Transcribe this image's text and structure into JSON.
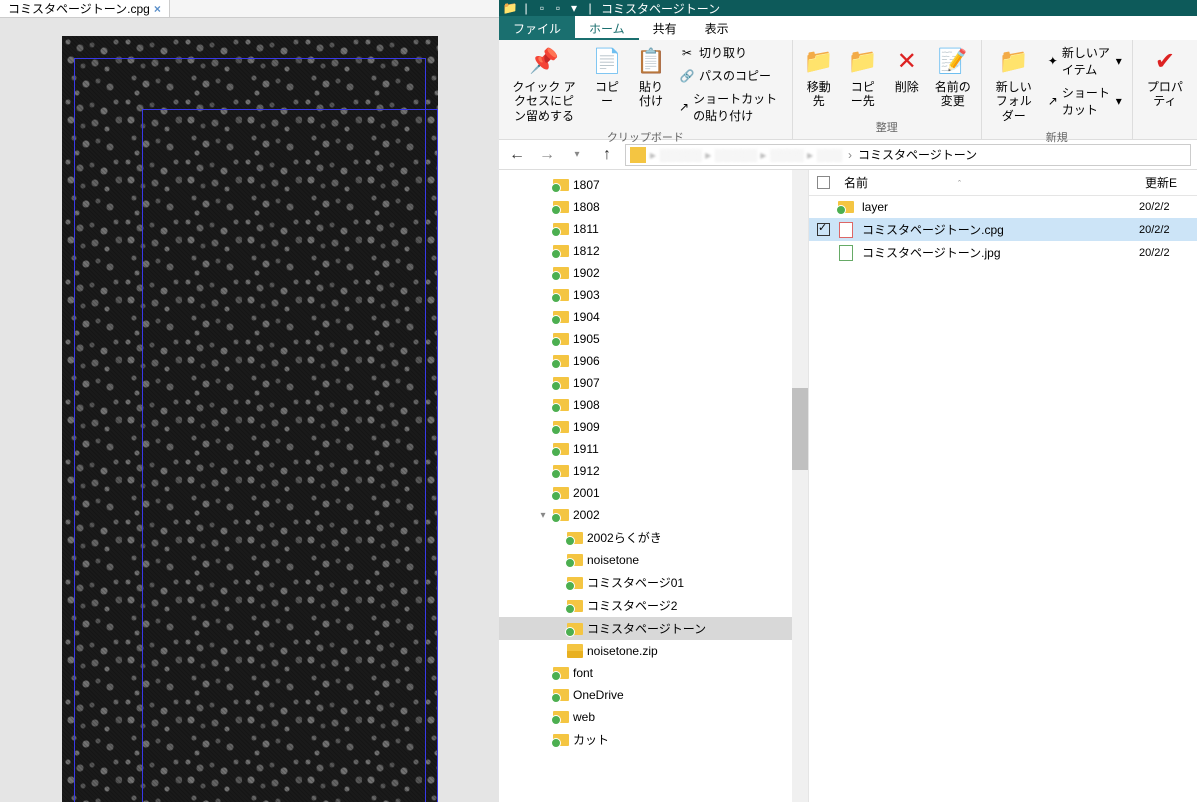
{
  "editor": {
    "tab_name": "コミスタページトーン.cpg"
  },
  "explorer": {
    "title": "コミスタページトーン",
    "menu": {
      "file": "ファイル",
      "home": "ホーム",
      "share": "共有",
      "view": "表示"
    },
    "ribbon": {
      "pin": "クイック アクセスにピン留めする",
      "copy": "コピー",
      "paste": "貼り付け",
      "cut": "切り取り",
      "copy_path": "パスのコピー",
      "paste_shortcut": "ショートカットの貼り付け",
      "clipboard": "クリップボード",
      "move_to": "移動先",
      "copy_to": "コピー先",
      "delete": "削除",
      "rename": "名前の変更",
      "organize": "整理",
      "new_folder": "新しいフォルダー",
      "new_item": "新しいアイテム",
      "shortcut": "ショートカット",
      "new": "新規",
      "properties": "プロパティ"
    },
    "breadcrumb": {
      "current": "コミスタページトーン"
    },
    "tree": [
      {
        "name": "1807",
        "indent": 2,
        "chev": ""
      },
      {
        "name": "1808",
        "indent": 2,
        "chev": ""
      },
      {
        "name": "1811",
        "indent": 2,
        "chev": ""
      },
      {
        "name": "1812",
        "indent": 2,
        "chev": ""
      },
      {
        "name": "1902",
        "indent": 2,
        "chev": ""
      },
      {
        "name": "1903",
        "indent": 2,
        "chev": ""
      },
      {
        "name": "1904",
        "indent": 2,
        "chev": ""
      },
      {
        "name": "1905",
        "indent": 2,
        "chev": ""
      },
      {
        "name": "1906",
        "indent": 2,
        "chev": ""
      },
      {
        "name": "1907",
        "indent": 2,
        "chev": ""
      },
      {
        "name": "1908",
        "indent": 2,
        "chev": ""
      },
      {
        "name": "1909",
        "indent": 2,
        "chev": ""
      },
      {
        "name": "1911",
        "indent": 2,
        "chev": ""
      },
      {
        "name": "1912",
        "indent": 2,
        "chev": ""
      },
      {
        "name": "2001",
        "indent": 2,
        "chev": ""
      },
      {
        "name": "2002",
        "indent": 2,
        "chev": "▾"
      },
      {
        "name": "2002らくがき",
        "indent": 3,
        "chev": ""
      },
      {
        "name": "noisetone",
        "indent": 3,
        "chev": ""
      },
      {
        "name": "コミスタページ01",
        "indent": 3,
        "chev": ""
      },
      {
        "name": "コミスタページ2",
        "indent": 3,
        "chev": ""
      },
      {
        "name": "コミスタページトーン",
        "indent": 3,
        "chev": "",
        "sel": true
      },
      {
        "name": "noisetone.zip",
        "indent": 3,
        "chev": "",
        "type": "zip"
      },
      {
        "name": "font",
        "indent": 2,
        "chev": ""
      },
      {
        "name": "OneDrive",
        "indent": 2,
        "chev": ""
      },
      {
        "name": "web",
        "indent": 2,
        "chev": ""
      },
      {
        "name": "カット",
        "indent": 2,
        "chev": ""
      }
    ],
    "list_header": {
      "name": "名前",
      "date": "更新E"
    },
    "files": [
      {
        "name": "layer",
        "date": "20/2/2",
        "type": "folder"
      },
      {
        "name": "コミスタページトーン.cpg",
        "date": "20/2/2",
        "type": "cpg",
        "sel": true
      },
      {
        "name": "コミスタページトーン.jpg",
        "date": "20/2/2",
        "type": "jpg"
      }
    ]
  }
}
